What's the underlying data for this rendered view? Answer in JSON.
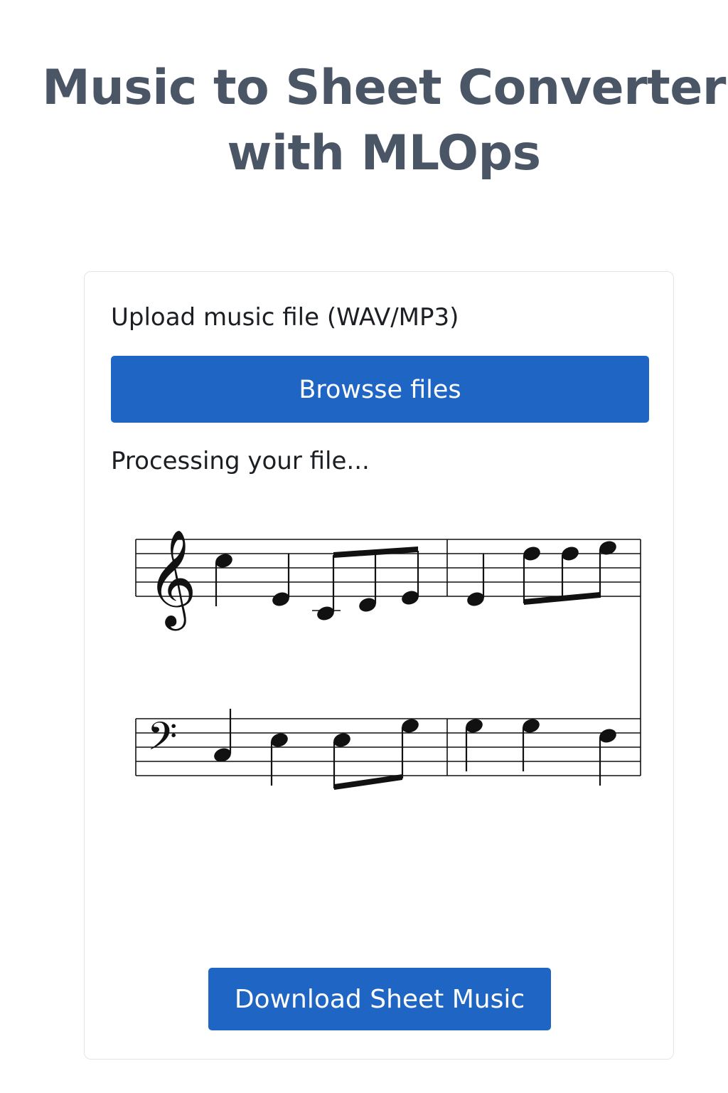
{
  "header": {
    "title_line1": "Music to Sheet Converter",
    "title_line2": "with MLOps"
  },
  "uploader": {
    "label": "Upload music file (WAV/MP3)",
    "browse_label": "Browsse files"
  },
  "status": {
    "text": "Processing your file..."
  },
  "sheet_music": {
    "treble_clef_glyph": "𝄞",
    "bass_clef_glyph": "𝄢"
  },
  "actions": {
    "download_label": "Download Sheet Music"
  },
  "colors": {
    "accent": "#1f66c4",
    "title": "#4a5565",
    "text": "#1b1e23",
    "card_border": "#e2e4e8"
  }
}
